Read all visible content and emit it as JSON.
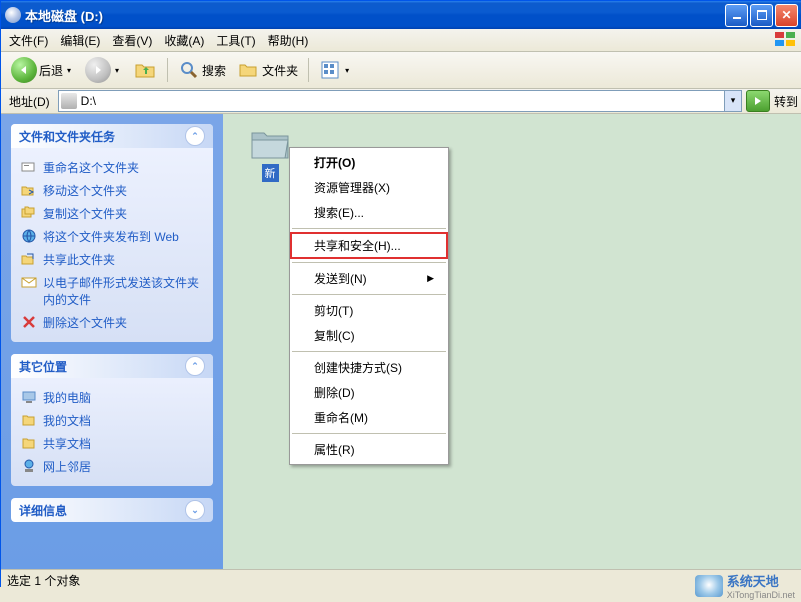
{
  "window": {
    "title": "本地磁盘 (D:)"
  },
  "menubar": {
    "file": "文件(F)",
    "edit": "编辑(E)",
    "view": "查看(V)",
    "favorites": "收藏(A)",
    "tools": "工具(T)",
    "help": "帮助(H)"
  },
  "toolbar": {
    "back": "后退",
    "search": "搜索",
    "folders": "文件夹"
  },
  "addressbar": {
    "label": "地址(D)",
    "path": "D:\\",
    "go": "转到"
  },
  "sidebar": {
    "panel1": {
      "title": "文件和文件夹任务",
      "items": [
        "重命名这个文件夹",
        "移动这个文件夹",
        "复制这个文件夹",
        "将这个文件夹发布到 Web",
        "共享此文件夹",
        "以电子邮件形式发送该文件夹内的文件",
        "删除这个文件夹"
      ]
    },
    "panel2": {
      "title": "其它位置",
      "items": [
        "我的电脑",
        "我的文档",
        "共享文档",
        "网上邻居"
      ]
    },
    "panel3": {
      "title": "详细信息"
    }
  },
  "content": {
    "folder_name": "新"
  },
  "context_menu": {
    "open": "打开(O)",
    "explorer": "资源管理器(X)",
    "search": "搜索(E)...",
    "sharing": "共享和安全(H)...",
    "sendto": "发送到(N)",
    "cut": "剪切(T)",
    "copy": "复制(C)",
    "create_shortcut": "创建快捷方式(S)",
    "delete": "删除(D)",
    "rename": "重命名(M)",
    "properties": "属性(R)"
  },
  "statusbar": {
    "text": "选定 1 个对象"
  },
  "watermark": {
    "main": "系统天地",
    "sub": "XiTongTianDi.net"
  }
}
